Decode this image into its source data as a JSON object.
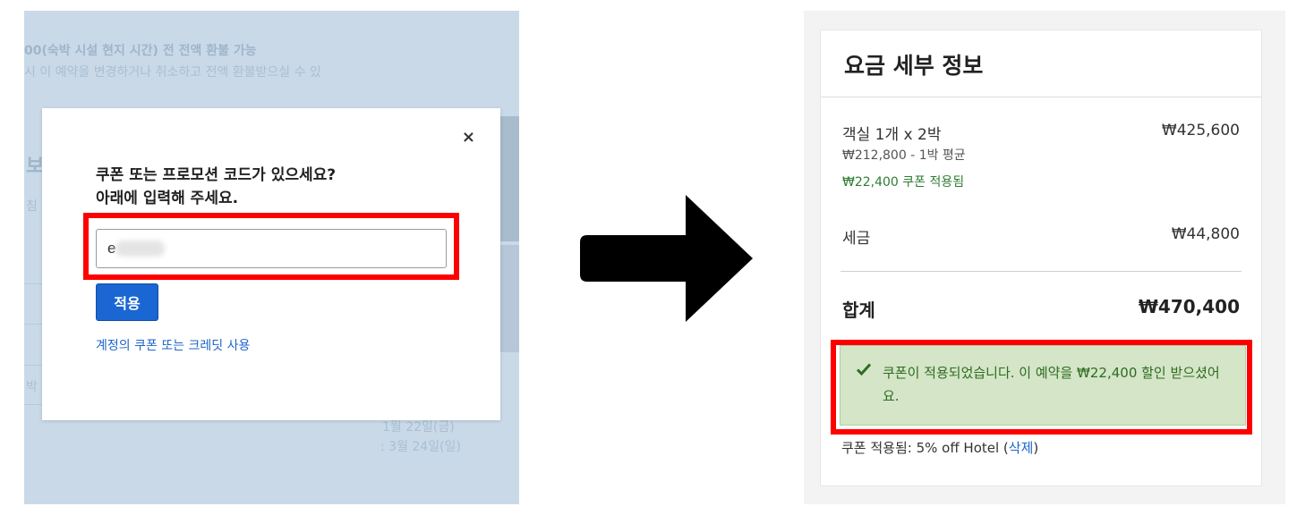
{
  "left": {
    "background_text": {
      "policy_title": "00(숙박 시설 현지 시간) 전 전액 환불 가능",
      "policy_desc": "시 이 예약을 변경하거나 취소하고 전액 환불받으실 수 있",
      "frag_bo": "보",
      "frag_chim": "침",
      "frag_bak": "박",
      "checkin_date": "1월 22일(금)",
      "checkout_date": ": 3월 24일(일)"
    },
    "modal": {
      "close_icon": "×",
      "heading_line1": "쿠폰 또는 프로모션 코드가 있으세요?",
      "heading_line2": "아래에 입력해 주세요.",
      "code_value": "e",
      "apply_label": "적용",
      "account_link": "계정의 쿠폰 또는 크레딧 사용"
    },
    "highlight_color": "#ff0000"
  },
  "right": {
    "title": "요금 세부 정보",
    "rooms": {
      "label": "객실 1개 x 2박",
      "value": "₩425,600",
      "avg": "₩212,800 - 1박 평균",
      "coupon_note": "₩22,400 쿠폰 적용됨"
    },
    "tax": {
      "label": "세금",
      "value": "₩44,800"
    },
    "total": {
      "label": "합계",
      "value": "₩470,400"
    },
    "success_message": "쿠폰이 적용되었습니다. 이 예약을 ₩22,400 할인 받으셨어요.",
    "coupon_applied_prefix": "쿠폰 적용됨: 5% off Hotel (",
    "remove_label": "삭제",
    "coupon_applied_suffix": ")",
    "success_bg_color": "#d4e6c7",
    "success_text_color": "#2f6b22",
    "link_color": "#1f66c9"
  },
  "arrow_icon": "right-arrow-icon"
}
